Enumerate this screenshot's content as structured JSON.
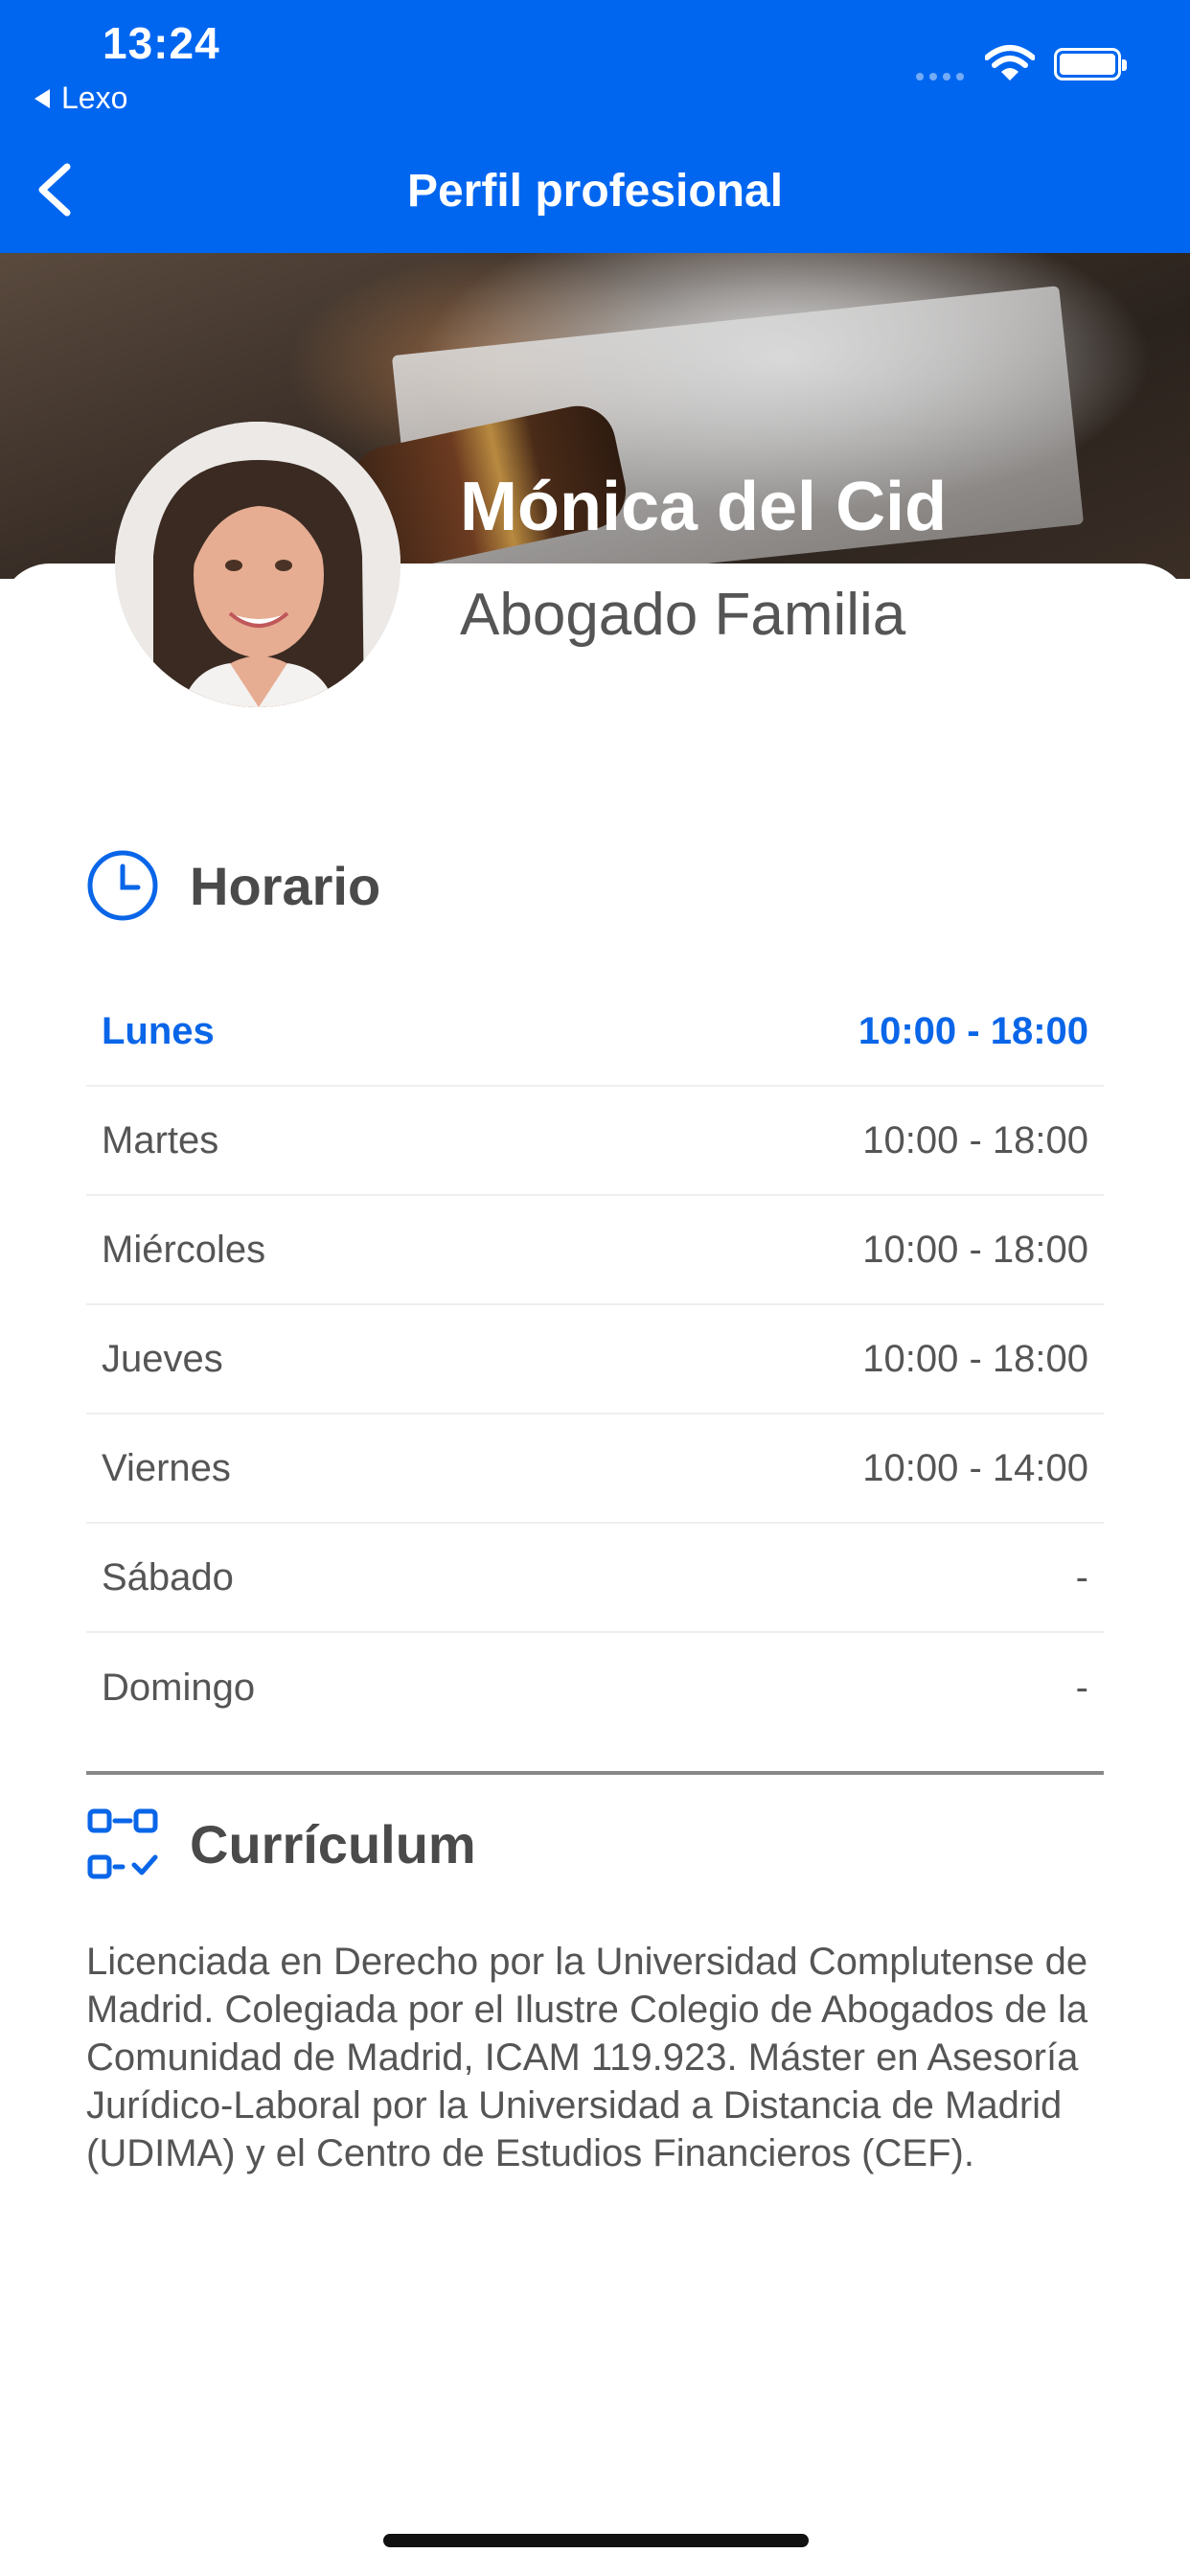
{
  "status_bar": {
    "time": "13:24",
    "back_app": "Lexo"
  },
  "nav": {
    "title": "Perfil profesional"
  },
  "profile": {
    "name": "Mónica del Cid",
    "role": "Abogado Familia"
  },
  "schedule": {
    "title": "Horario",
    "rows": [
      {
        "day": "Lunes",
        "hours": "10:00 - 18:00",
        "active": true
      },
      {
        "day": "Martes",
        "hours": "10:00 - 18:00"
      },
      {
        "day": "Miércoles",
        "hours": "10:00 - 18:00"
      },
      {
        "day": "Jueves",
        "hours": "10:00 - 18:00"
      },
      {
        "day": "Viernes",
        "hours": "10:00 - 14:00"
      },
      {
        "day": "Sábado",
        "hours": "-"
      },
      {
        "day": "Domingo",
        "hours": "-"
      }
    ]
  },
  "curriculum": {
    "title": "Currículum",
    "text": "Licenciada en Derecho por la Universidad Complutense de Madrid. Colegiada por el Ilustre Colegio de Abogados de la Comunidad de Madrid, ICAM 119.923. Máster en Asesoría Jurídico-Laboral por la Universidad a Distancia de Madrid (UDIMA) y el Centro de Estudios Financieros (CEF)."
  },
  "icons": [
    "chevron-left-icon",
    "clock-icon",
    "curriculum-icon",
    "wifi-icon",
    "battery-icon"
  ],
  "colors": {
    "primary": "#0066f0",
    "active_text": "#0a66e8",
    "text": "#555555"
  }
}
